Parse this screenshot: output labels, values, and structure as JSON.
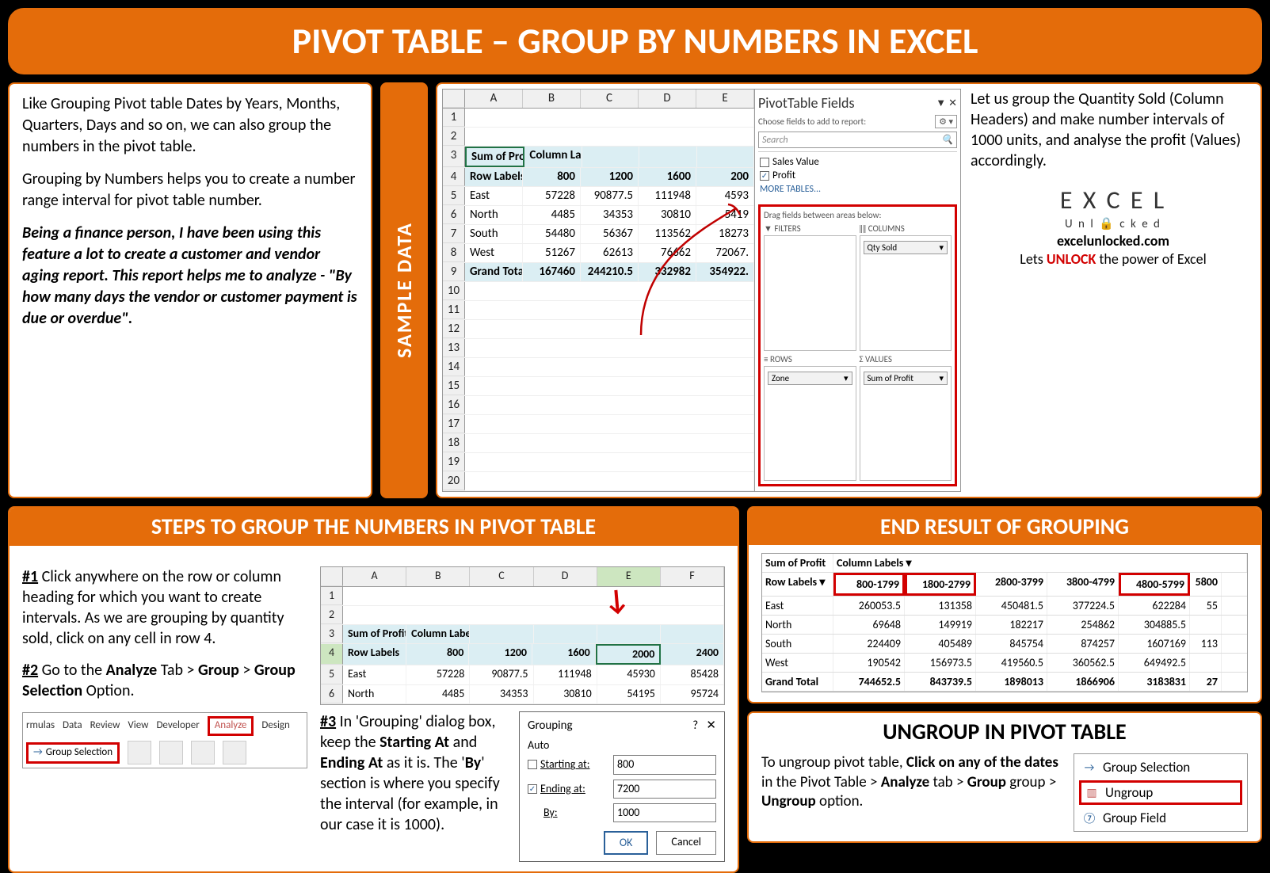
{
  "header": "PIVOT TABLE – GROUP BY NUMBERS IN EXCEL",
  "intro": {
    "p1": "Like Grouping Pivot table Dates by Years, Months, Quarters, Days and so on, we can also group the numbers in the pivot table.",
    "p2": "Grouping by Numbers helps you to create a number range interval for pivot table number.",
    "p3": "Being a finance person, I have been using this feature a lot to create a customer and vendor aging report. This report helps me to analyze - \"By how many days the vendor or customer payment is due or overdue\"."
  },
  "sample_tab": "SAMPLE DATA",
  "sample_sheet": {
    "cols": [
      "A",
      "B",
      "C",
      "D",
      "E"
    ],
    "rows": [
      [
        "Sum of Profit",
        "Column Labels",
        "",
        "",
        ""
      ],
      [
        "Row Labels",
        "800",
        "1200",
        "1600",
        "200"
      ],
      [
        "East",
        "57228",
        "90877.5",
        "111948",
        "4593"
      ],
      [
        "North",
        "4485",
        "34353",
        "30810",
        "5419"
      ],
      [
        "South",
        "54480",
        "56367",
        "113562",
        "18273"
      ],
      [
        "West",
        "51267",
        "62613",
        "76662",
        "72067."
      ],
      [
        "Grand Total",
        "167460",
        "244210.5",
        "332982",
        "354922."
      ]
    ]
  },
  "fields_pane": {
    "title": "PivotTable Fields",
    "subtitle": "Choose fields to add to report:",
    "search_ph": "Search",
    "checks": [
      {
        "label": "Sales Value",
        "checked": false
      },
      {
        "label": "Profit",
        "checked": true
      }
    ],
    "more": "MORE TABLES...",
    "areas_title": "Drag fields between areas below:",
    "filters": "FILTERS",
    "columns": "COLUMNS",
    "rows": "ROWS",
    "values": "VALUES",
    "col_field": "Qty Sold",
    "row_field": "Zone",
    "val_field": "Sum of Profit"
  },
  "right_text": {
    "p1": "Let us group the Quantity Sold (Column Headers) and make number intervals of 1000 units, and analyse the profit (Values) accordingly.",
    "brand_top": "E X C E L",
    "brand_sub": "U n l   c k e d",
    "site": "excelunlocked.com",
    "tagline_pre": "Lets ",
    "tagline_unlock": "UNLOCK",
    "tagline_post": " the power of Excel"
  },
  "steps_title": "STEPS TO GROUP THE NUMBERS IN PIVOT TABLE",
  "steps": {
    "s1_pre": "#1",
    "s1": " Click anywhere on the row or column heading for which you want to create intervals. As we are grouping by quantity sold, click on any cell in row 4.",
    "s2_pre": "#2",
    "s2_a": " Go to the ",
    "s2_analyze": "Analyze",
    "s2_b": " Tab > ",
    "s2_group": "Group",
    "s2_c": " > ",
    "s2_gs": "Group Selection",
    "s2_d": " Option.",
    "s3_pre": "#3",
    "s3_a": " In 'Grouping' dialog box, keep the ",
    "s3_start": "Starting At",
    "s3_b": " and ",
    "s3_end": "Ending At",
    "s3_c": " as it is. The '",
    "s3_by": "By",
    "s3_d": "' section is where you specify the interval (for example, in our case it is 1000)."
  },
  "ribbon": {
    "tabs": [
      "rmulas",
      "Data",
      "Review",
      "View",
      "Developer",
      "Analyze",
      "Design"
    ],
    "group_sel": "Group Selection"
  },
  "mini_sheet": {
    "cols": [
      "A",
      "B",
      "C",
      "D",
      "E",
      "F"
    ],
    "rows": [
      [
        "Sum of Profit",
        "Column Labels",
        "",
        "",
        "",
        ""
      ],
      [
        "Row Labels",
        "800",
        "1200",
        "1600",
        "2000",
        "2400"
      ],
      [
        "East",
        "57228",
        "90877.5",
        "111948",
        "45930",
        "85428"
      ],
      [
        "North",
        "4485",
        "34353",
        "30810",
        "54195",
        "95724"
      ]
    ]
  },
  "grouping_dialog": {
    "title": "Grouping",
    "auto": "Auto",
    "starting_lbl": "Starting at:",
    "ending_lbl": "Ending at:",
    "by_lbl": "By:",
    "starting_val": "800",
    "ending_val": "7200",
    "by_val": "1000",
    "ok": "OK",
    "cancel": "Cancel"
  },
  "result_title": "END RESULT OF GROUPING",
  "result_table": {
    "header1": [
      "Sum of Profit",
      "Column Labels"
    ],
    "header2": [
      "Row Labels",
      "800-1799",
      "1800-2799",
      "2800-3799",
      "3800-4799",
      "4800-5799",
      "5800"
    ],
    "rows": [
      [
        "East",
        "260053.5",
        "131358",
        "450481.5",
        "377224.5",
        "622284",
        "55"
      ],
      [
        "North",
        "69648",
        "149919",
        "182217",
        "254862",
        "304885.5",
        ""
      ],
      [
        "South",
        "224409",
        "405489",
        "845754",
        "874257",
        "1607169",
        "113"
      ],
      [
        "West",
        "190542",
        "156973.5",
        "419560.5",
        "360562.5",
        "649492.5",
        ""
      ],
      [
        "Grand Total",
        "744652.5",
        "843739.5",
        "1898013",
        "1866906",
        "3183831",
        "27"
      ]
    ]
  },
  "ungroup_title": "UNGROUP IN PIVOT TABLE",
  "ungroup": {
    "pre": "To ungroup pivot table, ",
    "b1": "Click on any of the dates",
    "mid1": " in the Pivot Table > ",
    "b2": "Analyze",
    "mid2": " tab > ",
    "b3": "Group",
    "mid3": " group > ",
    "b4": "Ungroup",
    "post": " option."
  },
  "ungroup_menu": {
    "i1": "Group Selection",
    "i2": "Ungroup",
    "i3": "Group Field"
  }
}
